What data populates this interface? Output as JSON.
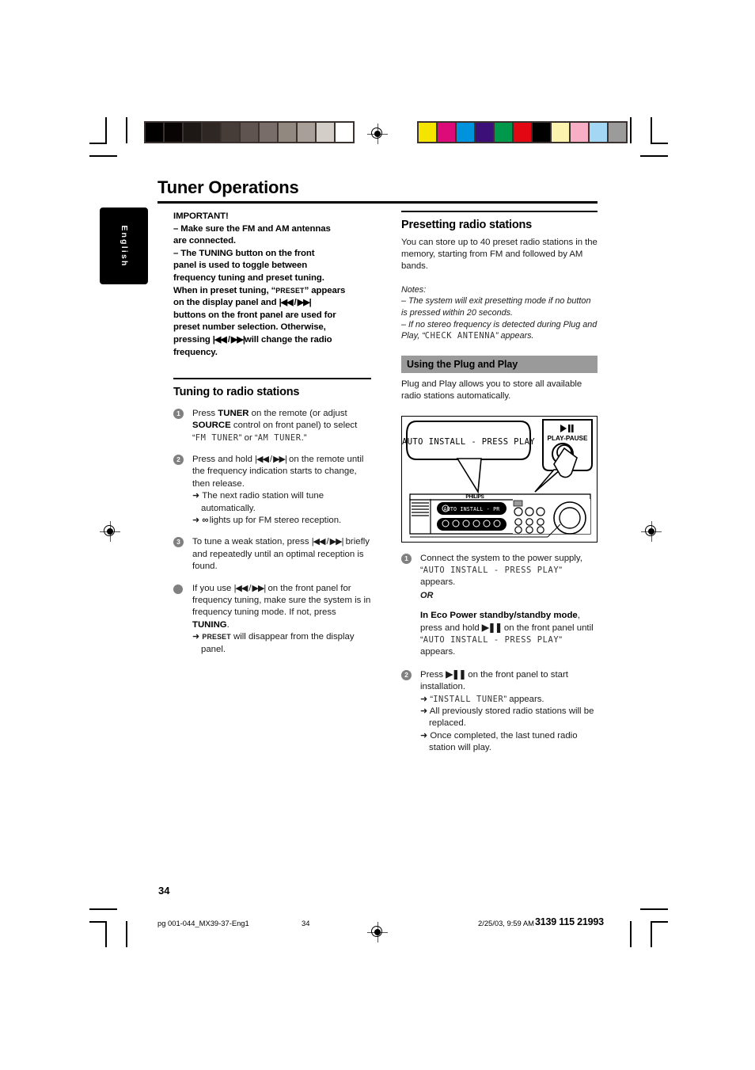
{
  "document": {
    "page_title": "Tuner Operations",
    "page_number": "34",
    "language_tab": "English"
  },
  "calibration": {
    "grayscale_swatches": [
      "#000000",
      "#080404",
      "#1d1715",
      "#2f2724",
      "#463c38",
      "#5f5450",
      "#786d68",
      "#918880",
      "#a89f98",
      "#d3cec8",
      "#ffffff"
    ],
    "color_swatches": [
      "#f5e400",
      "#dd0a7a",
      "#0093dd",
      "#3c0f78",
      "#00984a",
      "#e30613",
      "#000000",
      "#fbf3ae",
      "#f8aec4",
      "#a3d7f4",
      "#9b9b9b"
    ]
  },
  "left_column": {
    "important_heading": "IMPORTANT!",
    "important_line_1_prefix": "–  Make sure the FM and AM antennas",
    "important_line_1_cont": "are connected.",
    "important_line_2_a": "–  The",
    "important_line_2_b": "TUNING",
    "important_line_2_c": "button on the front",
    "important_line_3": "panel is used to toggle between",
    "important_line_4": "frequency tuning and preset tuning.",
    "important_line_5_a": "When in preset tuning, “",
    "important_preset_caps": "PRESET",
    "important_line_5_b": "” appears",
    "important_line_6_a": "on the display panel and",
    "important_line_6_b": "buttons on the front panel are used for",
    "important_line_7": "preset number selection.  Otherwise,",
    "important_line_8_a": "pressing",
    "important_line_8_b": "will change the radio",
    "important_line_9": "frequency.",
    "tuning_heading": "Tuning to radio stations",
    "steps": [
      {
        "num": "1",
        "text_a": "Press ",
        "bold_a": "TUNER",
        "text_b": " on the remote (or adjust ",
        "bold_b": "SOURCE",
        "text_c": " control on front panel) to select ",
        "quote_open": "“",
        "lcd_a": "FM TUNER",
        "quote_mid": "” or “",
        "lcd_b": "AM TUNER",
        "quote_close": ".”"
      },
      {
        "num": "2",
        "text_a": "Press and hold ",
        "text_b": " on the remote until the frequency indication starts to change, then release.",
        "subs": [
          "The next radio station will tune automatically.",
          "lights up for FM stereo reception."
        ]
      },
      {
        "num": "3",
        "text_a": "To tune a weak station, press ",
        "text_b": " briefly and repeatedly until an optimal reception is found."
      },
      {
        "num": "bullet",
        "text_a": "If you use ",
        "text_b": " on the front panel for frequency tuning, make sure the system is in frequency tuning mode.  If not, press ",
        "bold_b": "TUNING",
        "text_c": ".",
        "sub_caps": "PRESET",
        "sub_rest": " will disappear from the display panel."
      }
    ]
  },
  "right_column": {
    "presetting_heading": "Presetting radio stations",
    "presetting_body": "You can store up to 40 preset radio stations in the memory, starting from FM and followed by AM bands.",
    "notes_label": "Notes:",
    "note_1": "–  The system will exit presetting mode if no button is pressed within 20 seconds.",
    "note_2_a": "–  If no stereo frequency is detected during Plug and Play, “",
    "note_2_lcd": "CHECK ANTENNA",
    "note_2_b": "” appears.",
    "plugplay_heading": "Using the Plug and Play",
    "plugplay_body": "Plug and Play allows you to store all available radio stations automatically.",
    "illustration": {
      "callout_display_text": "AUTO INSTALL - PRESS PLAY",
      "callout_button_label": "PLAY-PAUSE",
      "panel_display_text": "AUTO INSTALL - PR",
      "panel_brand": "PHILIPS"
    },
    "steps": [
      {
        "num": "1",
        "text_a": "Connect the system to the power supply, “",
        "lcd_a": "AUTO INSTALL - PRESS PLAY",
        "text_b": "” appears.",
        "or_label": "OR",
        "bold_line": "In Eco Power standby/standby mode",
        "text_c": ", press and hold ",
        "text_d": " on the front panel until “",
        "lcd_b": "AUTO INSTALL - PRESS PLAY",
        "text_e": "” appears."
      },
      {
        "num": "2",
        "text_a": "Press ",
        "text_b": " on the front panel to start installation.",
        "sub_1_quote_open": "“",
        "sub_1_lcd": "INSTALL TUNER",
        "sub_1_rest": "” appears.",
        "sub_2": "All previously stored radio stations will be replaced.",
        "sub_3": "Once completed, the last tuned radio station will play."
      }
    ]
  },
  "footer": {
    "file_name": "pg 001-044_MX39-37-Eng1",
    "page": "34",
    "timestamp": "2/25/03, 9:59 AM",
    "doc_code": "3139 115 21993"
  }
}
